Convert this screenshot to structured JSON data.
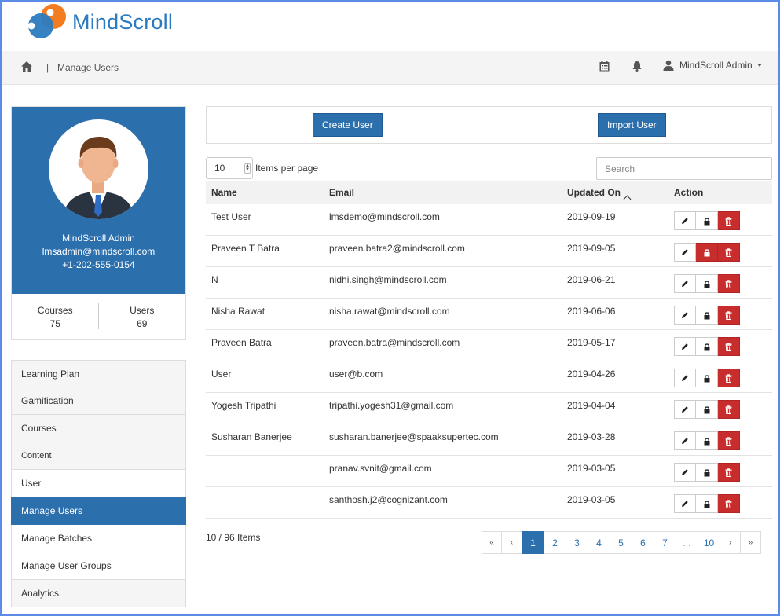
{
  "app": {
    "logo_text": "MindScroll",
    "brand_color": "#2c7bc0",
    "accent_color": "#2c6fad",
    "danger_color": "#c72d2d"
  },
  "topbar": {
    "home_icon": "home-icon",
    "separator": "|",
    "page": "Manage Users",
    "calendar_icon": "calendar-icon",
    "bell_icon": "bell-icon",
    "user_label": "MindScroll Admin"
  },
  "profile": {
    "name": "MindScroll Admin",
    "email": "lmsadmin@mindscroll.com",
    "phone": "+1-202-555-0154",
    "courses_label": "Courses",
    "courses_value": "75",
    "users_label": "Users",
    "users_value": "69"
  },
  "menu": [
    {
      "label": "Learning Plan",
      "type": "main"
    },
    {
      "label": "Gamification",
      "type": "main"
    },
    {
      "label": "Courses",
      "type": "main"
    },
    {
      "label": "Content",
      "type": "section"
    },
    {
      "label": "User",
      "type": "main"
    },
    {
      "label": "Manage Users",
      "type": "active"
    },
    {
      "label": "Manage Batches",
      "type": "sub"
    },
    {
      "label": "Manage User Groups",
      "type": "sub"
    },
    {
      "label": "Analytics",
      "type": "main"
    }
  ],
  "actions": {
    "create_user": "Create User",
    "import_user": "Import User"
  },
  "list_controls": {
    "per_page_value": "10",
    "per_page_label": "Items per page",
    "search_placeholder": "Search"
  },
  "table": {
    "headers": {
      "name": "Name",
      "email": "Email",
      "updated_on": "Updated On",
      "action": "Action"
    },
    "rows": [
      {
        "name": "Test User",
        "email": "lmsdemo@mindscroll.com",
        "date": "2019-09-19",
        "locked": false
      },
      {
        "name": "Praveen T Batra",
        "email": "praveen.batra2@mindscroll.com",
        "date": "2019-09-05",
        "locked": true
      },
      {
        "name": "N",
        "email": "nidhi.singh@mindscroll.com",
        "date": "2019-06-21",
        "locked": false
      },
      {
        "name": "Nisha Rawat",
        "email": "nisha.rawat@mindscroll.com",
        "date": "2019-06-06",
        "locked": false
      },
      {
        "name": "Praveen Batra",
        "email": "praveen.batra@mindscroll.com",
        "date": "2019-05-17",
        "locked": false
      },
      {
        "name": "User",
        "email": "user@b.com",
        "date": "2019-04-26",
        "locked": false
      },
      {
        "name": "Yogesh Tripathi",
        "email": "tripathi.yogesh31@gmail.com",
        "date": "2019-04-04",
        "locked": false
      },
      {
        "name": "Susharan Banerjee",
        "email": "susharan.banerjee@spaaksupertec.com",
        "date": "2019-03-28",
        "locked": false
      },
      {
        "name": "",
        "email": "pranav.svnit@gmail.com",
        "date": "2019-03-05",
        "locked": false
      },
      {
        "name": "",
        "email": "santhosh.j2@cognizant.com",
        "date": "2019-03-05",
        "locked": false
      }
    ]
  },
  "footer": {
    "count": "10 / 96 Items",
    "pages": [
      "«",
      "‹",
      "1",
      "2",
      "3",
      "4",
      "5",
      "6",
      "7",
      "...",
      "10",
      "›",
      "»"
    ],
    "current_page": "1"
  }
}
